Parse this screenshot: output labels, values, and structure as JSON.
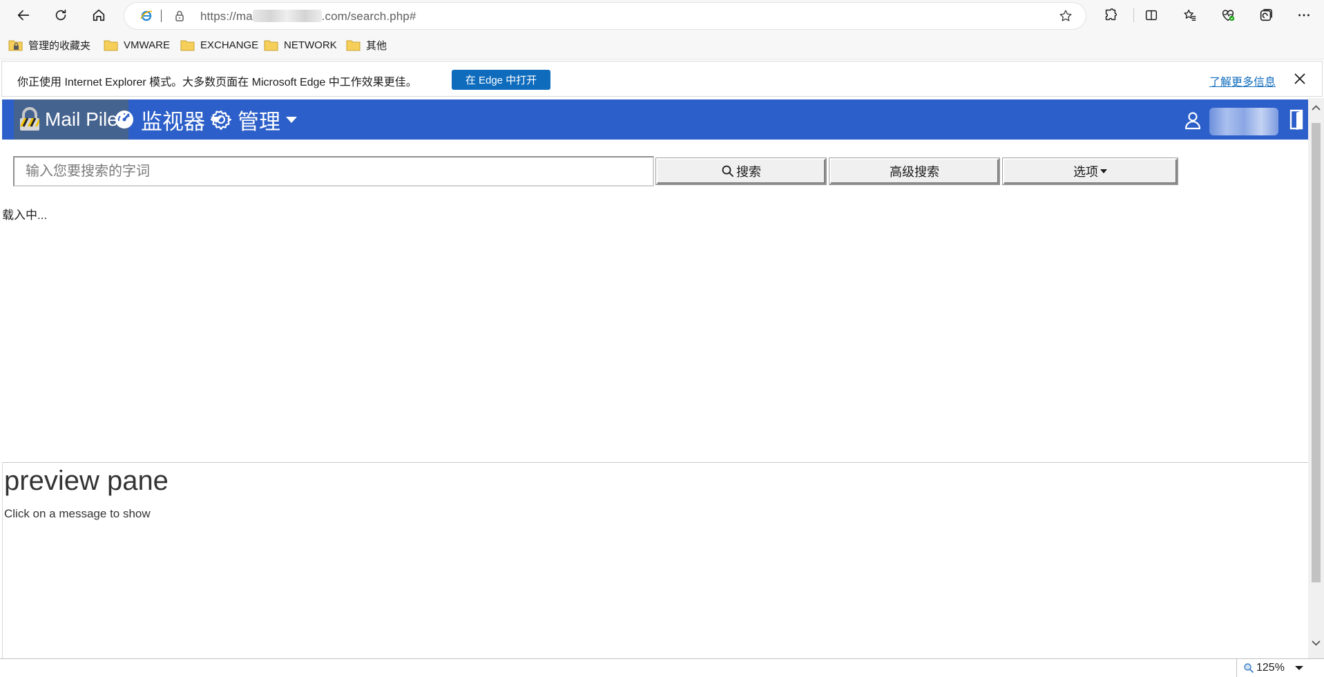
{
  "browser": {
    "url_prefix": "https://ma",
    "url_suffix": ".com/search.php#",
    "favorites": [
      {
        "label": "管理的收藏夹",
        "icon": "managed-favorites-folder-icon"
      },
      {
        "label": "VMWARE",
        "icon": "folder-icon"
      },
      {
        "label": "EXCHANGE",
        "icon": "folder-icon"
      },
      {
        "label": "NETWORK",
        "icon": "folder-icon"
      },
      {
        "label": "其他",
        "icon": "folder-icon"
      }
    ]
  },
  "infobar": {
    "message": "你正使用 Internet Explorer 模式。大多数页面在 Microsoft Edge 中工作效果更佳。",
    "open_button": "在 Edge 中打开",
    "learn_more": "了解更多信息"
  },
  "app": {
    "brand": "Mail Piler",
    "nav": {
      "monitor": "监视器",
      "admin": "管理"
    },
    "search": {
      "placeholder": "输入您要搜索的字词",
      "search_button": "搜索",
      "advanced_button": "高级搜索",
      "options_button": "选项"
    },
    "loading_text": "载入中...",
    "preview": {
      "title": "preview pane",
      "hint": "Click on a message to show"
    }
  },
  "status": {
    "zoom": "125%"
  },
  "colors": {
    "navbar": "#2c5fc9",
    "brand_bg": "#45638f",
    "edge_blue": "#0f6cbd"
  }
}
